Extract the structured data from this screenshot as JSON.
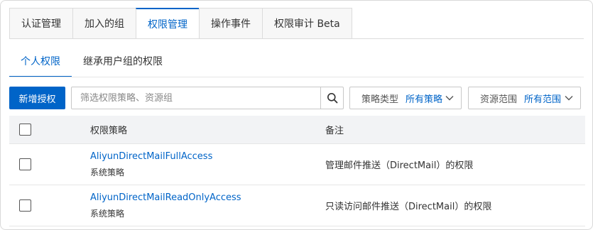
{
  "top_tabs": [
    {
      "label": "认证管理",
      "active": false
    },
    {
      "label": "加入的组",
      "active": false
    },
    {
      "label": "权限管理",
      "active": true
    },
    {
      "label": "操作事件",
      "active": false
    },
    {
      "label": "权限审计 Beta",
      "active": false
    }
  ],
  "sub_tabs": [
    {
      "label": "个人权限",
      "active": true
    },
    {
      "label": "继承用户组的权限",
      "active": false
    }
  ],
  "toolbar": {
    "add_button": "新增授权",
    "search_placeholder": "筛选权限策略、资源组",
    "policy_type_label": "策略类型",
    "policy_type_value": "所有策略",
    "scope_label": "资源范围",
    "scope_value": "所有范围"
  },
  "table": {
    "headers": {
      "policy": "权限策略",
      "note": "备注"
    },
    "rows": [
      {
        "name": "AliyunDirectMailFullAccess",
        "type": "系统策略",
        "note": "管理邮件推送（DirectMail）的权限"
      },
      {
        "name": "AliyunDirectMailReadOnlyAccess",
        "type": "系统策略",
        "note": "只读访问邮件推送（DirectMail）的权限"
      }
    ]
  },
  "colors": {
    "accent": "#0064c8",
    "header_bg": "#f2f3f5"
  }
}
